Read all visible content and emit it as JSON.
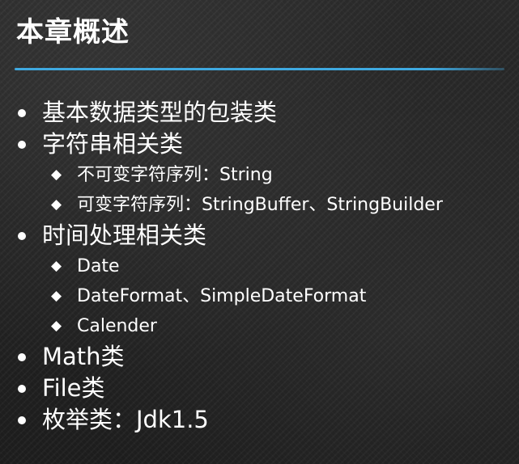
{
  "title": "本章概述",
  "accent_color": "#3fa9e0",
  "items": [
    {
      "text": "基本数据类型的包装类",
      "children": []
    },
    {
      "text": "字符串相关类",
      "children": [
        "不可变字符序列：String",
        "可变字符序列：StringBuffer、StringBuilder"
      ]
    },
    {
      "text": "时间处理相关类",
      "children": [
        "Date",
        "DateFormat、SimpleDateFormat",
        "Calender"
      ]
    },
    {
      "text": "Math类",
      "children": []
    },
    {
      "text": "File类",
      "children": []
    },
    {
      "text": "枚举类：Jdk1.5",
      "children": []
    }
  ],
  "bullet_icon": "disc-icon",
  "sub_bullet_icon": "diamond-icon"
}
